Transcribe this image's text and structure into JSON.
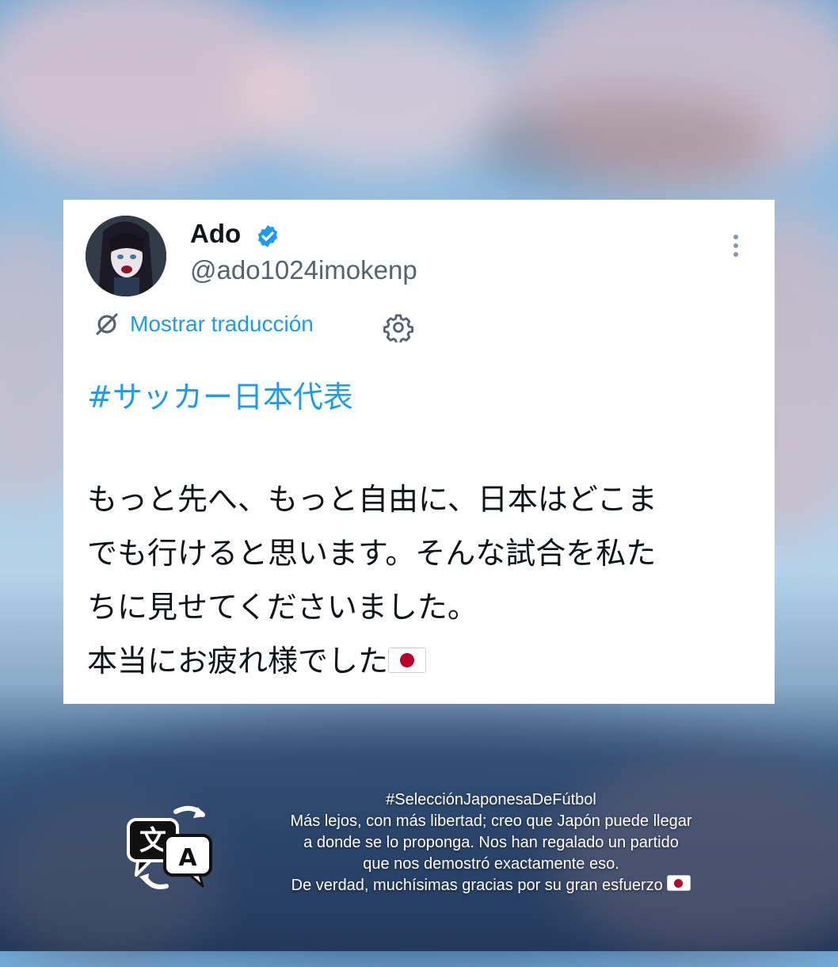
{
  "tweet": {
    "name": "Ado",
    "handle": "@ado1024imokenp",
    "translate_label": "Mostrar traducción",
    "hashtag": "#サッカー日本代表",
    "lines": [
      "もっと先へ、もっと自由に、日本はどこま",
      "でも行けると思います。そんな試合を私た",
      "ちに見せてくださいました。",
      "本当にお疲れ様でした"
    ],
    "icons": {
      "verified": "verified-badge-icon",
      "more": "more-options-icon",
      "translate": "translate-icon",
      "settings": "gear-icon",
      "flag": "japan-flag-emoji"
    },
    "colors": {
      "link": "#1d9bf0",
      "text": "#0f1419",
      "secondary": "#536471"
    }
  },
  "caption": {
    "lines": [
      "#SelecciónJaponesaDeFútbol",
      "Más lejos, con más libertad; creo que Japón puede llegar",
      "a donde se lo proponga. Nos han regalado un partido",
      "que nos demostró exactamente eso.",
      "De verdad, muchísimas gracias por su gran esfuerzo"
    ],
    "icon": "translation-icon"
  }
}
